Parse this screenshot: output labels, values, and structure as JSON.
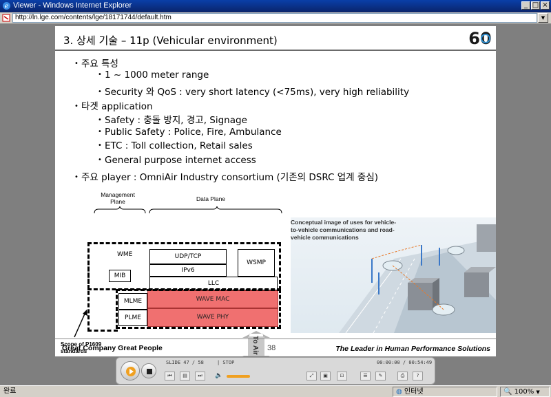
{
  "window": {
    "title": "Viewer - Windows Internet Explorer",
    "url": "http://ln.lge.com/contents/lge/18171744/default.htm",
    "min_glyph": "_",
    "max_glyph": "□",
    "close_glyph": "×"
  },
  "slide": {
    "title": "3. 상세 기술 – 11p (Vehicular environment)",
    "logo_text": "60",
    "bullets": [
      {
        "level": 1,
        "text": "주요 특성"
      },
      {
        "level": 2,
        "text": "1 ~ 1000 meter range"
      },
      {
        "level": 2,
        "text": "Security 와 QoS : very short latency (<75ms), very high reliability"
      },
      {
        "level": 1,
        "text": "타겟 application"
      },
      {
        "level": 2,
        "text": "Safety : 충돌 방지, 경고, Signage"
      },
      {
        "level": 2,
        "text": "Public Safety : Police, Fire, Ambulance"
      },
      {
        "level": 2,
        "text": "ETC : Toll collection, Retail sales"
      },
      {
        "level": 2,
        "text": "General purpose internet access"
      },
      {
        "level": 1,
        "text": "주요 player  : OmniAir Industry consortium (기존의 DSRC 업계 중심)"
      }
    ],
    "diagram": {
      "management_plane_label": "Management Plane",
      "data_plane_label": "Data Plane",
      "wme": "WME",
      "mib": "MIB",
      "udp_tcp": "UDP/TCP",
      "ipv6": "IPv6",
      "wsmp": "WSMP",
      "llc": "LLC",
      "mlme": "MLME",
      "plme": "PLME",
      "wave_mac": "WAVE MAC",
      "wave_phy": "WAVE PHY",
      "scope_label": "Scope of P1609 standards",
      "to_air": "To Air"
    },
    "image_caption": "Conceptual image of uses for vehicle-to-vehicle communications and road-vehicle communications",
    "footer_left": "Great Company   Great People",
    "page_number": "38",
    "footer_right": "The Leader in Human Performance Solutions"
  },
  "player": {
    "slide_info": "SLIDE  47 / 58",
    "state": "| STOP",
    "time": "00:00:00 / 00:54:49",
    "accent_color": "#f0a020"
  },
  "status": {
    "left": "완료",
    "zone": "인터넷",
    "zoom": "100%"
  }
}
